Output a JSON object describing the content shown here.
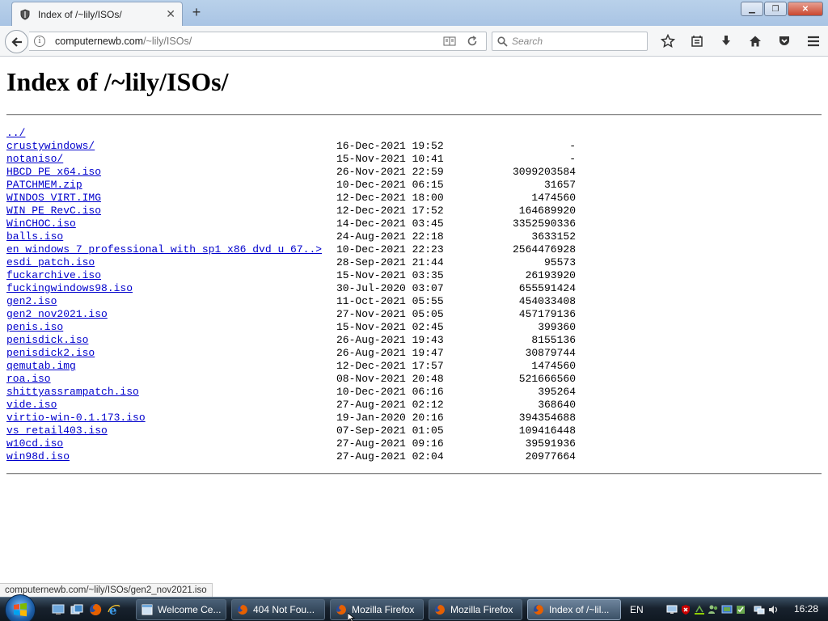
{
  "browser": {
    "tab_title": "Index of /~lily/ISOs/",
    "new_tab_symbol": "+",
    "url_host": "computernewb.com",
    "url_path": "/~lily/ISOs/",
    "search_placeholder": "Search"
  },
  "page": {
    "heading": "Index of /~lily/ISOs/",
    "entries": [
      {
        "name": "../",
        "date": "",
        "size": ""
      },
      {
        "name": "crustywindows/",
        "date": "16-Dec-2021 19:52",
        "size": "-"
      },
      {
        "name": "notaniso/",
        "date": "15-Nov-2021 10:41",
        "size": "-"
      },
      {
        "name": "HBCD_PE_x64.iso",
        "date": "26-Nov-2021 22:59",
        "size": "3099203584"
      },
      {
        "name": "PATCHMEM.zip",
        "date": "10-Dec-2021 06:15",
        "size": "31657"
      },
      {
        "name": "WINDOS_VIRT.IMG",
        "date": "12-Dec-2021 18:00",
        "size": "1474560"
      },
      {
        "name": "WIN_PE_RevC.iso",
        "date": "12-Dec-2021 17:52",
        "size": "164689920"
      },
      {
        "name": "WinCHOC.iso",
        "date": "14-Dec-2021 03:45",
        "size": "3352590336"
      },
      {
        "name": "balls.iso",
        "date": "24-Aug-2021 22:18",
        "size": "3633152"
      },
      {
        "name": "en_windows_7_professional_with_sp1_x86_dvd_u_67..>",
        "date": "10-Dec-2021 22:23",
        "size": "2564476928"
      },
      {
        "name": "esdi_patch.iso",
        "date": "28-Sep-2021 21:44",
        "size": "95573"
      },
      {
        "name": "fuckarchive.iso",
        "date": "15-Nov-2021 03:35",
        "size": "26193920"
      },
      {
        "name": "fuckingwindows98.iso",
        "date": "30-Jul-2020 03:07",
        "size": "655591424"
      },
      {
        "name": "gen2.iso",
        "date": "11-Oct-2021 05:55",
        "size": "454033408"
      },
      {
        "name": "gen2_nov2021.iso",
        "date": "27-Nov-2021 05:05",
        "size": "457179136"
      },
      {
        "name": "penis.iso",
        "date": "15-Nov-2021 02:45",
        "size": "399360"
      },
      {
        "name": "penisdick.iso",
        "date": "26-Aug-2021 19:43",
        "size": "8155136"
      },
      {
        "name": "penisdick2.iso",
        "date": "26-Aug-2021 19:47",
        "size": "30879744"
      },
      {
        "name": "qemutab.img",
        "date": "12-Dec-2021 17:57",
        "size": "1474560"
      },
      {
        "name": "roa.iso",
        "date": "08-Nov-2021 20:48",
        "size": "521666560"
      },
      {
        "name": "shittyassrampatch.iso",
        "date": "10-Dec-2021 06:16",
        "size": "395264"
      },
      {
        "name": "vide.iso",
        "date": "27-Aug-2021 02:12",
        "size": "368640"
      },
      {
        "name": "virtio-win-0.1.173.iso",
        "date": "19-Jan-2020 20:16",
        "size": "394354688"
      },
      {
        "name": "vs_retail403.iso",
        "date": "07-Sep-2021 01:05",
        "size": "109416448"
      },
      {
        "name": "w10cd.iso",
        "date": "27-Aug-2021 09:16",
        "size": "39591936"
      },
      {
        "name": "win98d.iso",
        "date": "27-Aug-2021 02:04",
        "size": "20977664"
      }
    ]
  },
  "status_bar": {
    "hover_url": "computernewb.com/~lily/ISOs/gen2_nov2021.iso"
  },
  "taskbar": {
    "buttons": [
      {
        "label": "Welcome Ce...",
        "icon": "window-icon",
        "active": false
      },
      {
        "label": "404 Not Fou...",
        "icon": "firefox-icon",
        "active": false
      },
      {
        "label": "Mozilla Firefox",
        "icon": "firefox-icon",
        "active": false
      },
      {
        "label": "Mozilla Firefox",
        "icon": "firefox-icon",
        "active": false
      },
      {
        "label": "Index of /~lil...",
        "icon": "firefox-icon",
        "active": true
      }
    ],
    "language": "EN",
    "clock": "16:28"
  },
  "colors": {
    "link": "#0000cc",
    "titlebar": "#b9d1ea",
    "taskbar": "#18222e",
    "firefox_orange": "#e66000"
  }
}
